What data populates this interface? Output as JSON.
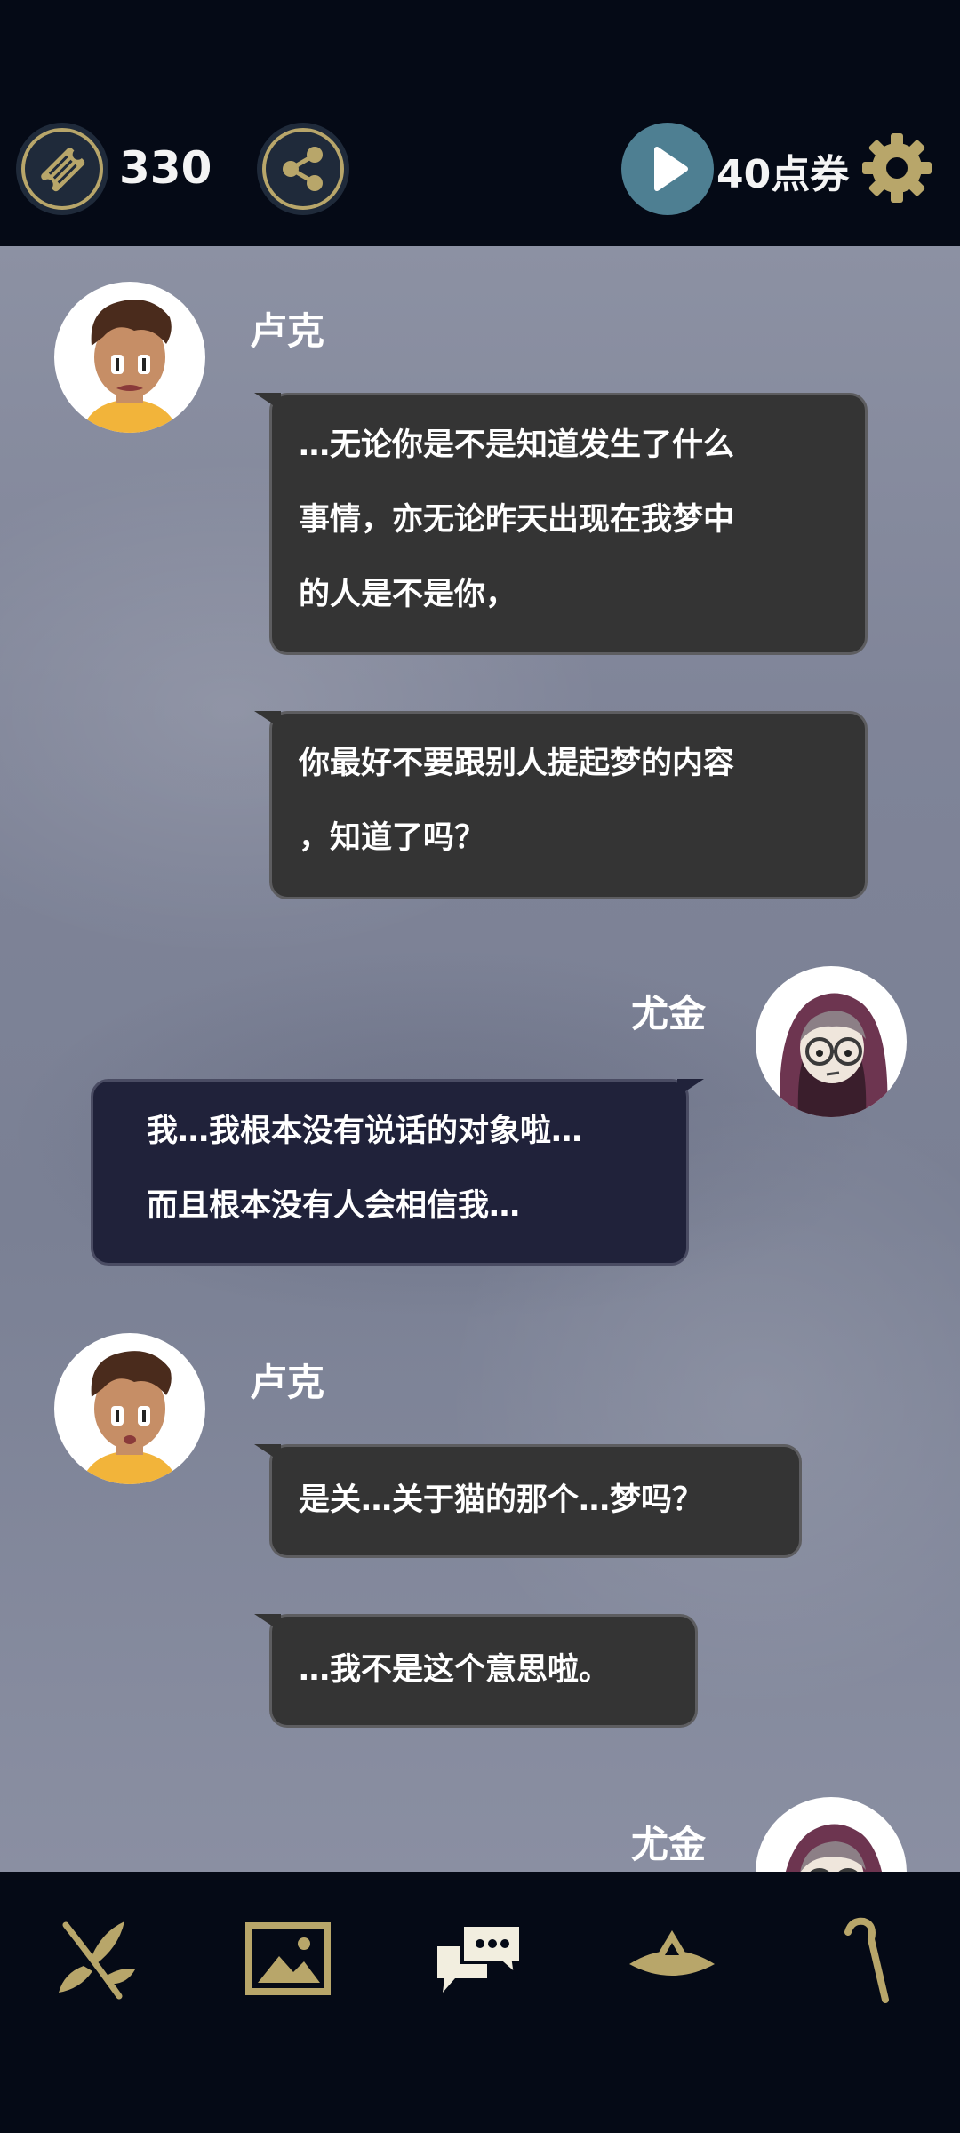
{
  "topbar": {
    "tickets_count": "330",
    "points_label": "40点券",
    "icons": [
      "ticket-icon",
      "share-icon",
      "play-icon",
      "gear-icon"
    ]
  },
  "messages": [
    {
      "speaker": "卢克",
      "lines": [
        "…无论你是不是知道发生了什么",
        "事情，亦无论昨天出现在我梦中",
        "的人是不是你，"
      ]
    },
    {
      "lines": [
        "你最好不要跟别人提起梦的内容",
        "，知道了吗？"
      ]
    },
    {
      "speaker": "尤金",
      "lines": [
        "我…我根本没有说话的对象啦…",
        "而且根本没有人会相信我…"
      ]
    },
    {
      "speaker": "卢克",
      "lines": [
        "是关…关于猫的那个…梦吗？"
      ]
    },
    {
      "lines": [
        "…我不是这个意思啦。"
      ]
    },
    {
      "speaker": "尤金"
    }
  ],
  "bottomnav": {
    "items": [
      "branch-icon",
      "gallery-icon",
      "chat-icon",
      "hat-icon",
      "cane-icon"
    ],
    "active": "chat-icon"
  },
  "colors": {
    "background": "#050a16",
    "accent_gold": "#b8a66a",
    "play_button": "#4e7f92",
    "bubble_luke": "#343434",
    "bubble_eugene": "#20223a"
  }
}
